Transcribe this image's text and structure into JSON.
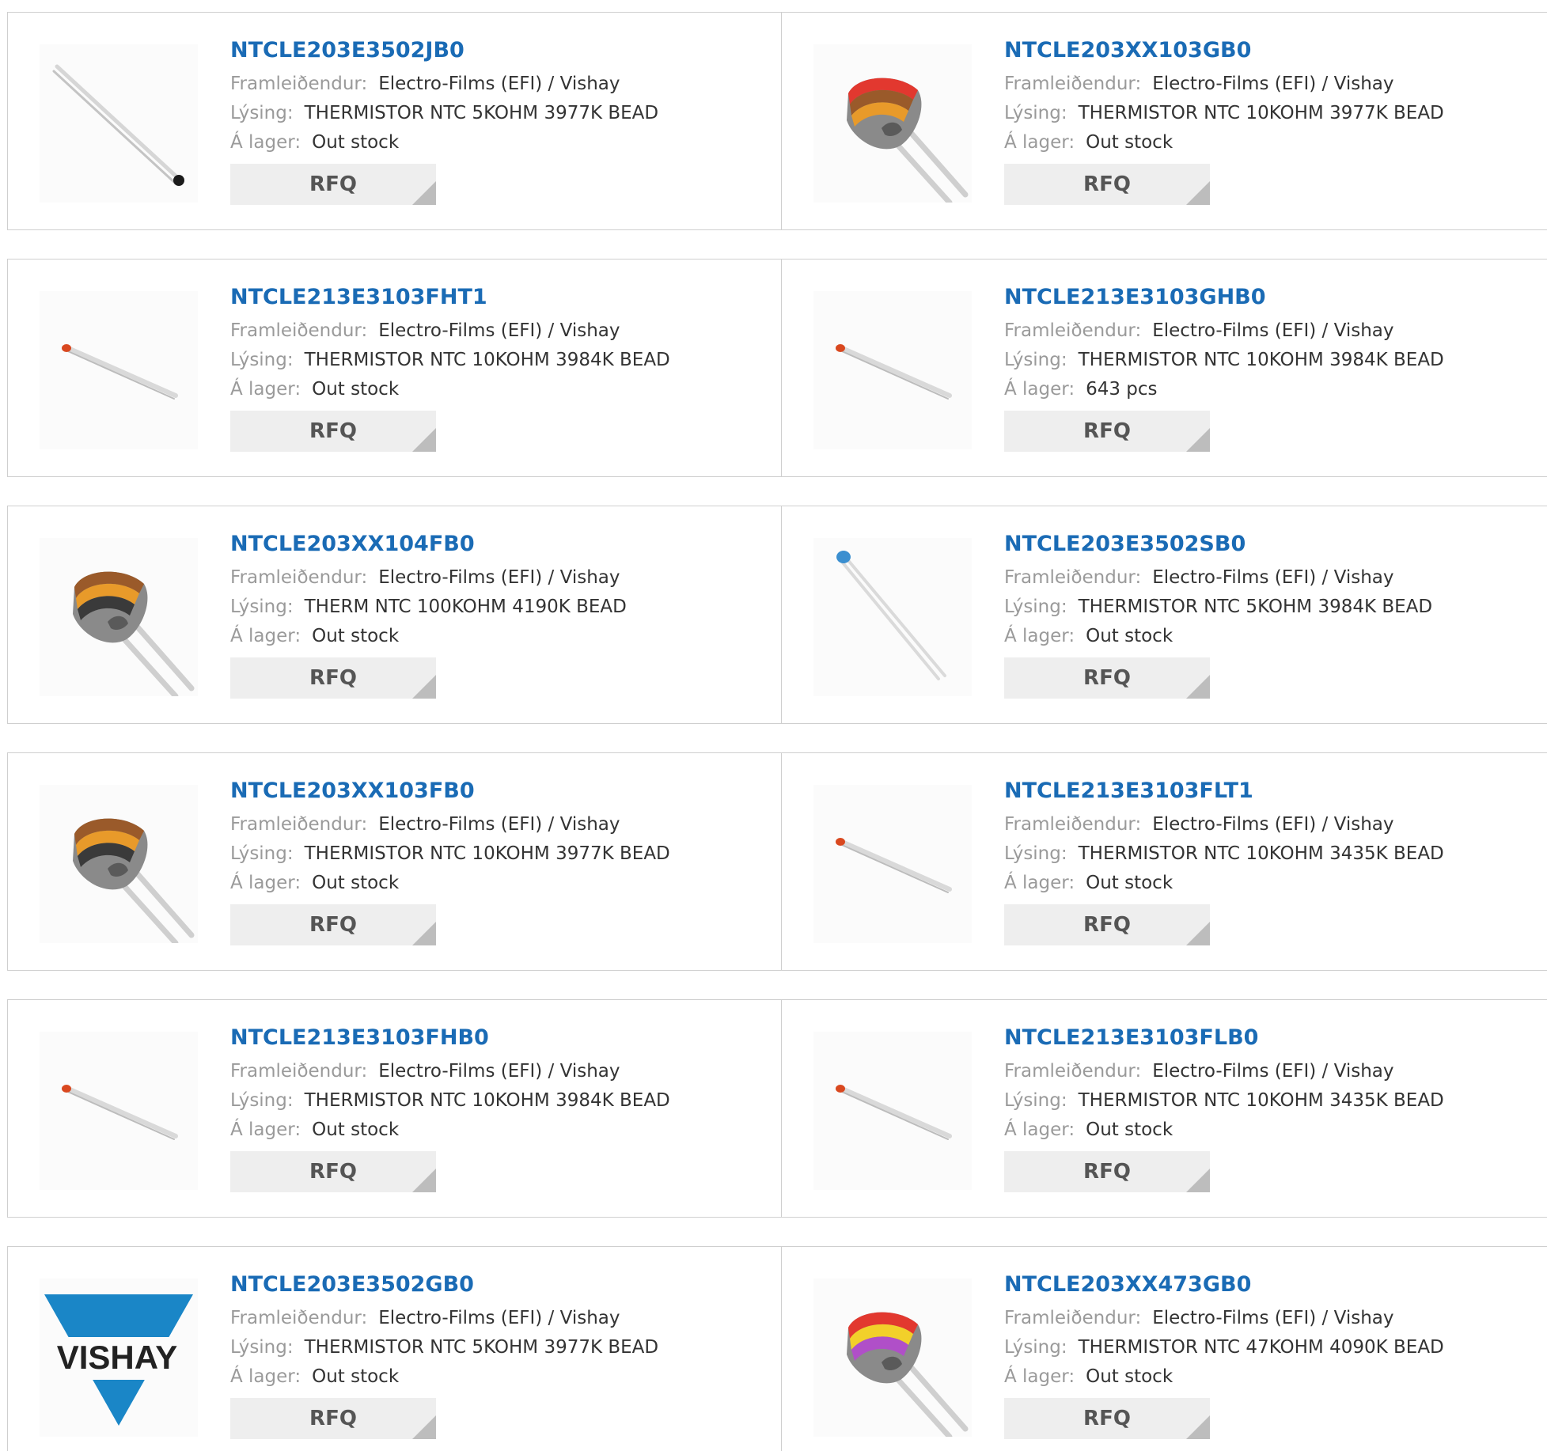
{
  "labels": {
    "manufacturer": "Framleiðendur:",
    "description": "Lýsing:",
    "stock": "Á lager:",
    "rfq": "RFQ"
  },
  "colors": {
    "link": "#1a6bb5",
    "label": "#9a9a9a",
    "value": "#333333",
    "border": "#cfcfcf",
    "button_bg": "#eeeeee",
    "vishay_blue": "#1a86c7"
  },
  "products": [
    {
      "name": "NTCLE203E3502JB0",
      "manufacturer": "Electro-Films (EFI) / Vishay",
      "description": "THERMISTOR NTC 5KOHM 3977K BEAD",
      "stock": "Out stock",
      "image": "thermistor-black-tip-diagonal"
    },
    {
      "name": "NTCLE203XX103GB0",
      "manufacturer": "Electro-Films (EFI) / Vishay",
      "description": "THERMISTOR NTC 10KOHM 3977K BEAD",
      "stock": "Out stock",
      "image": "thermistor-bead-red-brown-orange"
    },
    {
      "name": "NTCLE213E3103FHT1",
      "manufacturer": "Electro-Films (EFI) / Vishay",
      "description": "THERMISTOR NTC 10KOHM 3984K BEAD",
      "stock": "Out stock",
      "image": "thermistor-small-red-tip"
    },
    {
      "name": "NTCLE213E3103GHB0",
      "manufacturer": "Electro-Films (EFI) / Vishay",
      "description": "THERMISTOR NTC 10KOHM 3984K BEAD",
      "stock": "643 pcs",
      "image": "thermistor-small-red-tip"
    },
    {
      "name": "NTCLE203XX104FB0",
      "manufacturer": "Electro-Films (EFI) / Vishay",
      "description": "THERM NTC 100KOHM 4190K BEAD",
      "stock": "Out stock",
      "image": "thermistor-bead-brown-orange"
    },
    {
      "name": "NTCLE203E3502SB0",
      "manufacturer": "Electro-Films (EFI) / Vishay",
      "description": "THERMISTOR NTC 5KOHM 3984K BEAD",
      "stock": "Out stock",
      "image": "thermistor-blue-tip"
    },
    {
      "name": "NTCLE203XX103FB0",
      "manufacturer": "Electro-Films (EFI) / Vishay",
      "description": "THERMISTOR NTC 10KOHM 3977K BEAD",
      "stock": "Out stock",
      "image": "thermistor-bead-brown-orange"
    },
    {
      "name": "NTCLE213E3103FLT1",
      "manufacturer": "Electro-Films (EFI) / Vishay",
      "description": "THERMISTOR NTC 10KOHM 3435K BEAD",
      "stock": "Out stock",
      "image": "thermistor-small-red-tip"
    },
    {
      "name": "NTCLE213E3103FHB0",
      "manufacturer": "Electro-Films (EFI) / Vishay",
      "description": "THERMISTOR NTC 10KOHM 3984K BEAD",
      "stock": "Out stock",
      "image": "thermistor-small-red-tip"
    },
    {
      "name": "NTCLE213E3103FLB0",
      "manufacturer": "Electro-Films (EFI) / Vishay",
      "description": "THERMISTOR NTC 10KOHM 3435K BEAD",
      "stock": "Out stock",
      "image": "thermistor-small-red-tip"
    },
    {
      "name": "NTCLE203E3502GB0",
      "manufacturer": "Electro-Films (EFI) / Vishay",
      "description": "THERMISTOR NTC 5KOHM 3977K BEAD",
      "stock": "Out stock",
      "image": "vishay-logo",
      "logo_text": "VISHAY"
    },
    {
      "name": "NTCLE203XX473GB0",
      "manufacturer": "Electro-Films (EFI) / Vishay",
      "description": "THERMISTOR NTC 47KOHM 4090K BEAD",
      "stock": "Out stock",
      "image": "thermistor-bead-red-yellow-violet"
    }
  ]
}
